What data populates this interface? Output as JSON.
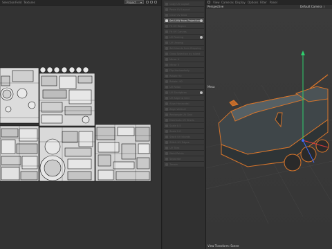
{
  "uv_editor": {
    "menu": [
      "Selection",
      "Field",
      "Textures"
    ],
    "project_select": "Project"
  },
  "commands": {
    "items": [
      {
        "label": "Copy UV Layout",
        "active": false
      },
      {
        "label": "Paste UV Layout",
        "active": false
      },
      {
        "label": "Clear UV Data",
        "active": false
      },
      {
        "label": "Set UVW from Projection",
        "active": true,
        "gear": true
      },
      {
        "label": "Fit UV Region",
        "active": false
      },
      {
        "label": "Fit UV Canvas",
        "active": false
      },
      {
        "label": "UV Packing",
        "active": false,
        "gear": true
      },
      {
        "label": "UV Unwrap",
        "active": false
      },
      {
        "label": "Set Islands from Mapping",
        "active": false
      },
      {
        "label": "Grow Selection by Island",
        "active": false
      },
      {
        "label": "Mirror U",
        "active": false
      },
      {
        "label": "Mirror V",
        "active": false
      },
      {
        "label": "Flip Horizontally",
        "active": false
      },
      {
        "label": "Rotate 90",
        "active": false
      },
      {
        "label": "Rotate -90",
        "active": false
      },
      {
        "label": "UV Relax",
        "active": false
      },
      {
        "label": "UV Straighten",
        "active": false,
        "gear": true
      },
      {
        "label": "UV Align to Grid",
        "active": false
      },
      {
        "label": "Align Horizontal",
        "active": false
      },
      {
        "label": "Align Vertical",
        "active": false
      },
      {
        "label": "Rectangle UV Grid",
        "active": false
      },
      {
        "label": "Distribute UV Shells",
        "active": false
      },
      {
        "label": "Scale 0.5",
        "active": false
      },
      {
        "label": "Scale 2.0",
        "active": false
      },
      {
        "label": "Stack UV Islands",
        "active": false
      },
      {
        "label": "Stitch UV Edges",
        "active": false
      },
      {
        "label": "UV Tiles",
        "active": false
      },
      {
        "label": "Weld Points",
        "active": false
      },
      {
        "label": "Separate",
        "active": false
      },
      {
        "label": "Terrain",
        "active": false
      }
    ]
  },
  "viewport": {
    "menu": [
      "View",
      "Cameras",
      "Display",
      "Options",
      "Filter",
      "Panel"
    ],
    "view_label": "Perspective",
    "camera_label": "Default Camera",
    "overlay_label": "Mesa",
    "footer_label": "View Transform: Scene",
    "colors": {
      "selection": "#d9762b",
      "axis_y": "#2fd06e",
      "axis_x": "#e23b3b",
      "axis_z": "#3f6bff",
      "model": "#3d4447"
    }
  }
}
